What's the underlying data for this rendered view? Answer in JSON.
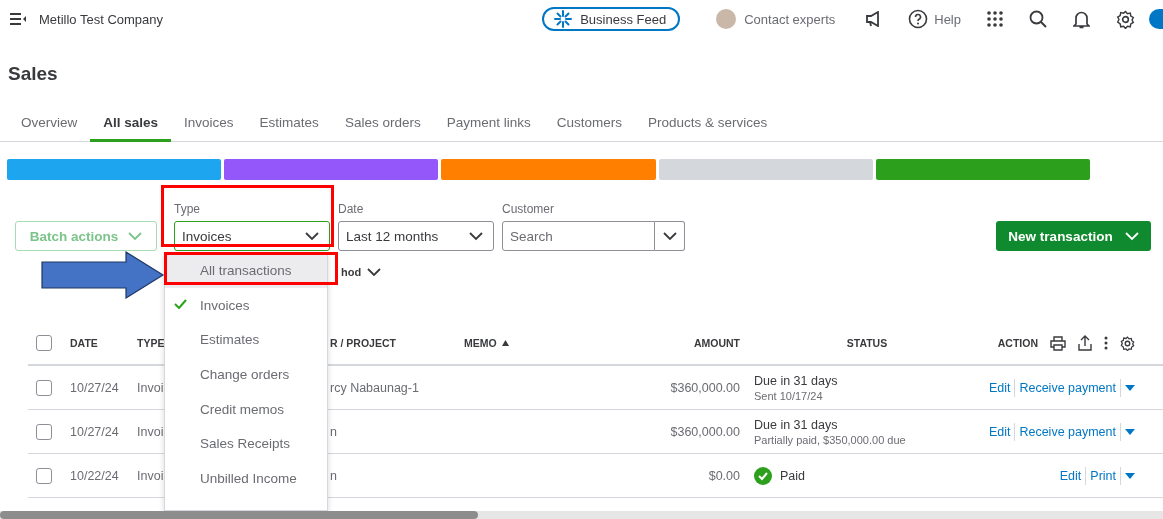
{
  "topbar": {
    "company": "Metillo Test Company",
    "feed_button": "Business Feed",
    "contact": "Contact experts",
    "help": "Help"
  },
  "page_title": "Sales",
  "tabs": [
    {
      "label": "Overview",
      "selected": false
    },
    {
      "label": "All sales",
      "selected": true
    },
    {
      "label": "Invoices",
      "selected": false
    },
    {
      "label": "Estimates",
      "selected": false
    },
    {
      "label": "Sales orders",
      "selected": false
    },
    {
      "label": "Payment links",
      "selected": false
    },
    {
      "label": "Customers",
      "selected": false
    },
    {
      "label": "Products & services",
      "selected": false
    }
  ],
  "status_strip": [
    {
      "color": "#1ea5f0"
    },
    {
      "color": "#9457fa"
    },
    {
      "color": "#ff8000"
    },
    {
      "color": "#d4d7dc"
    },
    {
      "color": "#2ca01c"
    }
  ],
  "filters": {
    "batch_actions": "Batch actions",
    "type_label": "Type",
    "type_value": "Invoices",
    "date_label": "Date",
    "date_value": "Last 12 months",
    "customer_label": "Customer",
    "customer_placeholder": "Search",
    "new_button": "New transaction",
    "fragment": "hod"
  },
  "type_menu": [
    {
      "label": "All transactions",
      "selected": false,
      "highlighted": true
    },
    {
      "label": "Invoices",
      "selected": true,
      "highlighted": false
    },
    {
      "label": "Estimates",
      "selected": false,
      "highlighted": false
    },
    {
      "label": "Change orders",
      "selected": false,
      "highlighted": false
    },
    {
      "label": "Credit memos",
      "selected": false,
      "highlighted": false
    },
    {
      "label": "Sales Receipts",
      "selected": false,
      "highlighted": false
    },
    {
      "label": "Unbilled Income",
      "selected": false,
      "highlighted": false
    }
  ],
  "table": {
    "select_all_checked": false,
    "columns": [
      {
        "label": "DATE",
        "sorted": false
      },
      {
        "label": "TYPE",
        "sorted": false
      },
      {
        "label": "R / PROJECT",
        "sorted": false
      },
      {
        "label": "MEMO",
        "sorted": true
      },
      {
        "label": "AMOUNT",
        "sorted": false
      },
      {
        "label": "STATUS",
        "sorted": false
      },
      {
        "label": "ACTION",
        "sorted": false
      }
    ],
    "rows": [
      {
        "checked": false,
        "date": "10/27/24",
        "type": "Invoi",
        "customer": "rcy Nabaunag-1",
        "amount": "$360,000.00",
        "status": "Due in 31 days",
        "note": "Sent 10/17/24",
        "paid": false,
        "actions": [
          "Edit",
          "Receive payment"
        ]
      },
      {
        "checked": false,
        "date": "10/27/24",
        "type": "Invoi",
        "customer": "n",
        "amount": "$360,000.00",
        "status": "Due in 31 days",
        "note": "Partially paid, $350,000.00 due",
        "paid": false,
        "actions": [
          "Edit",
          "Receive payment"
        ]
      },
      {
        "checked": false,
        "date": "10/22/24",
        "type": "Invoi",
        "customer": "n",
        "amount": "$0.00",
        "status": "Paid",
        "paid": true,
        "actions": [
          "Edit",
          "Print"
        ]
      }
    ]
  }
}
